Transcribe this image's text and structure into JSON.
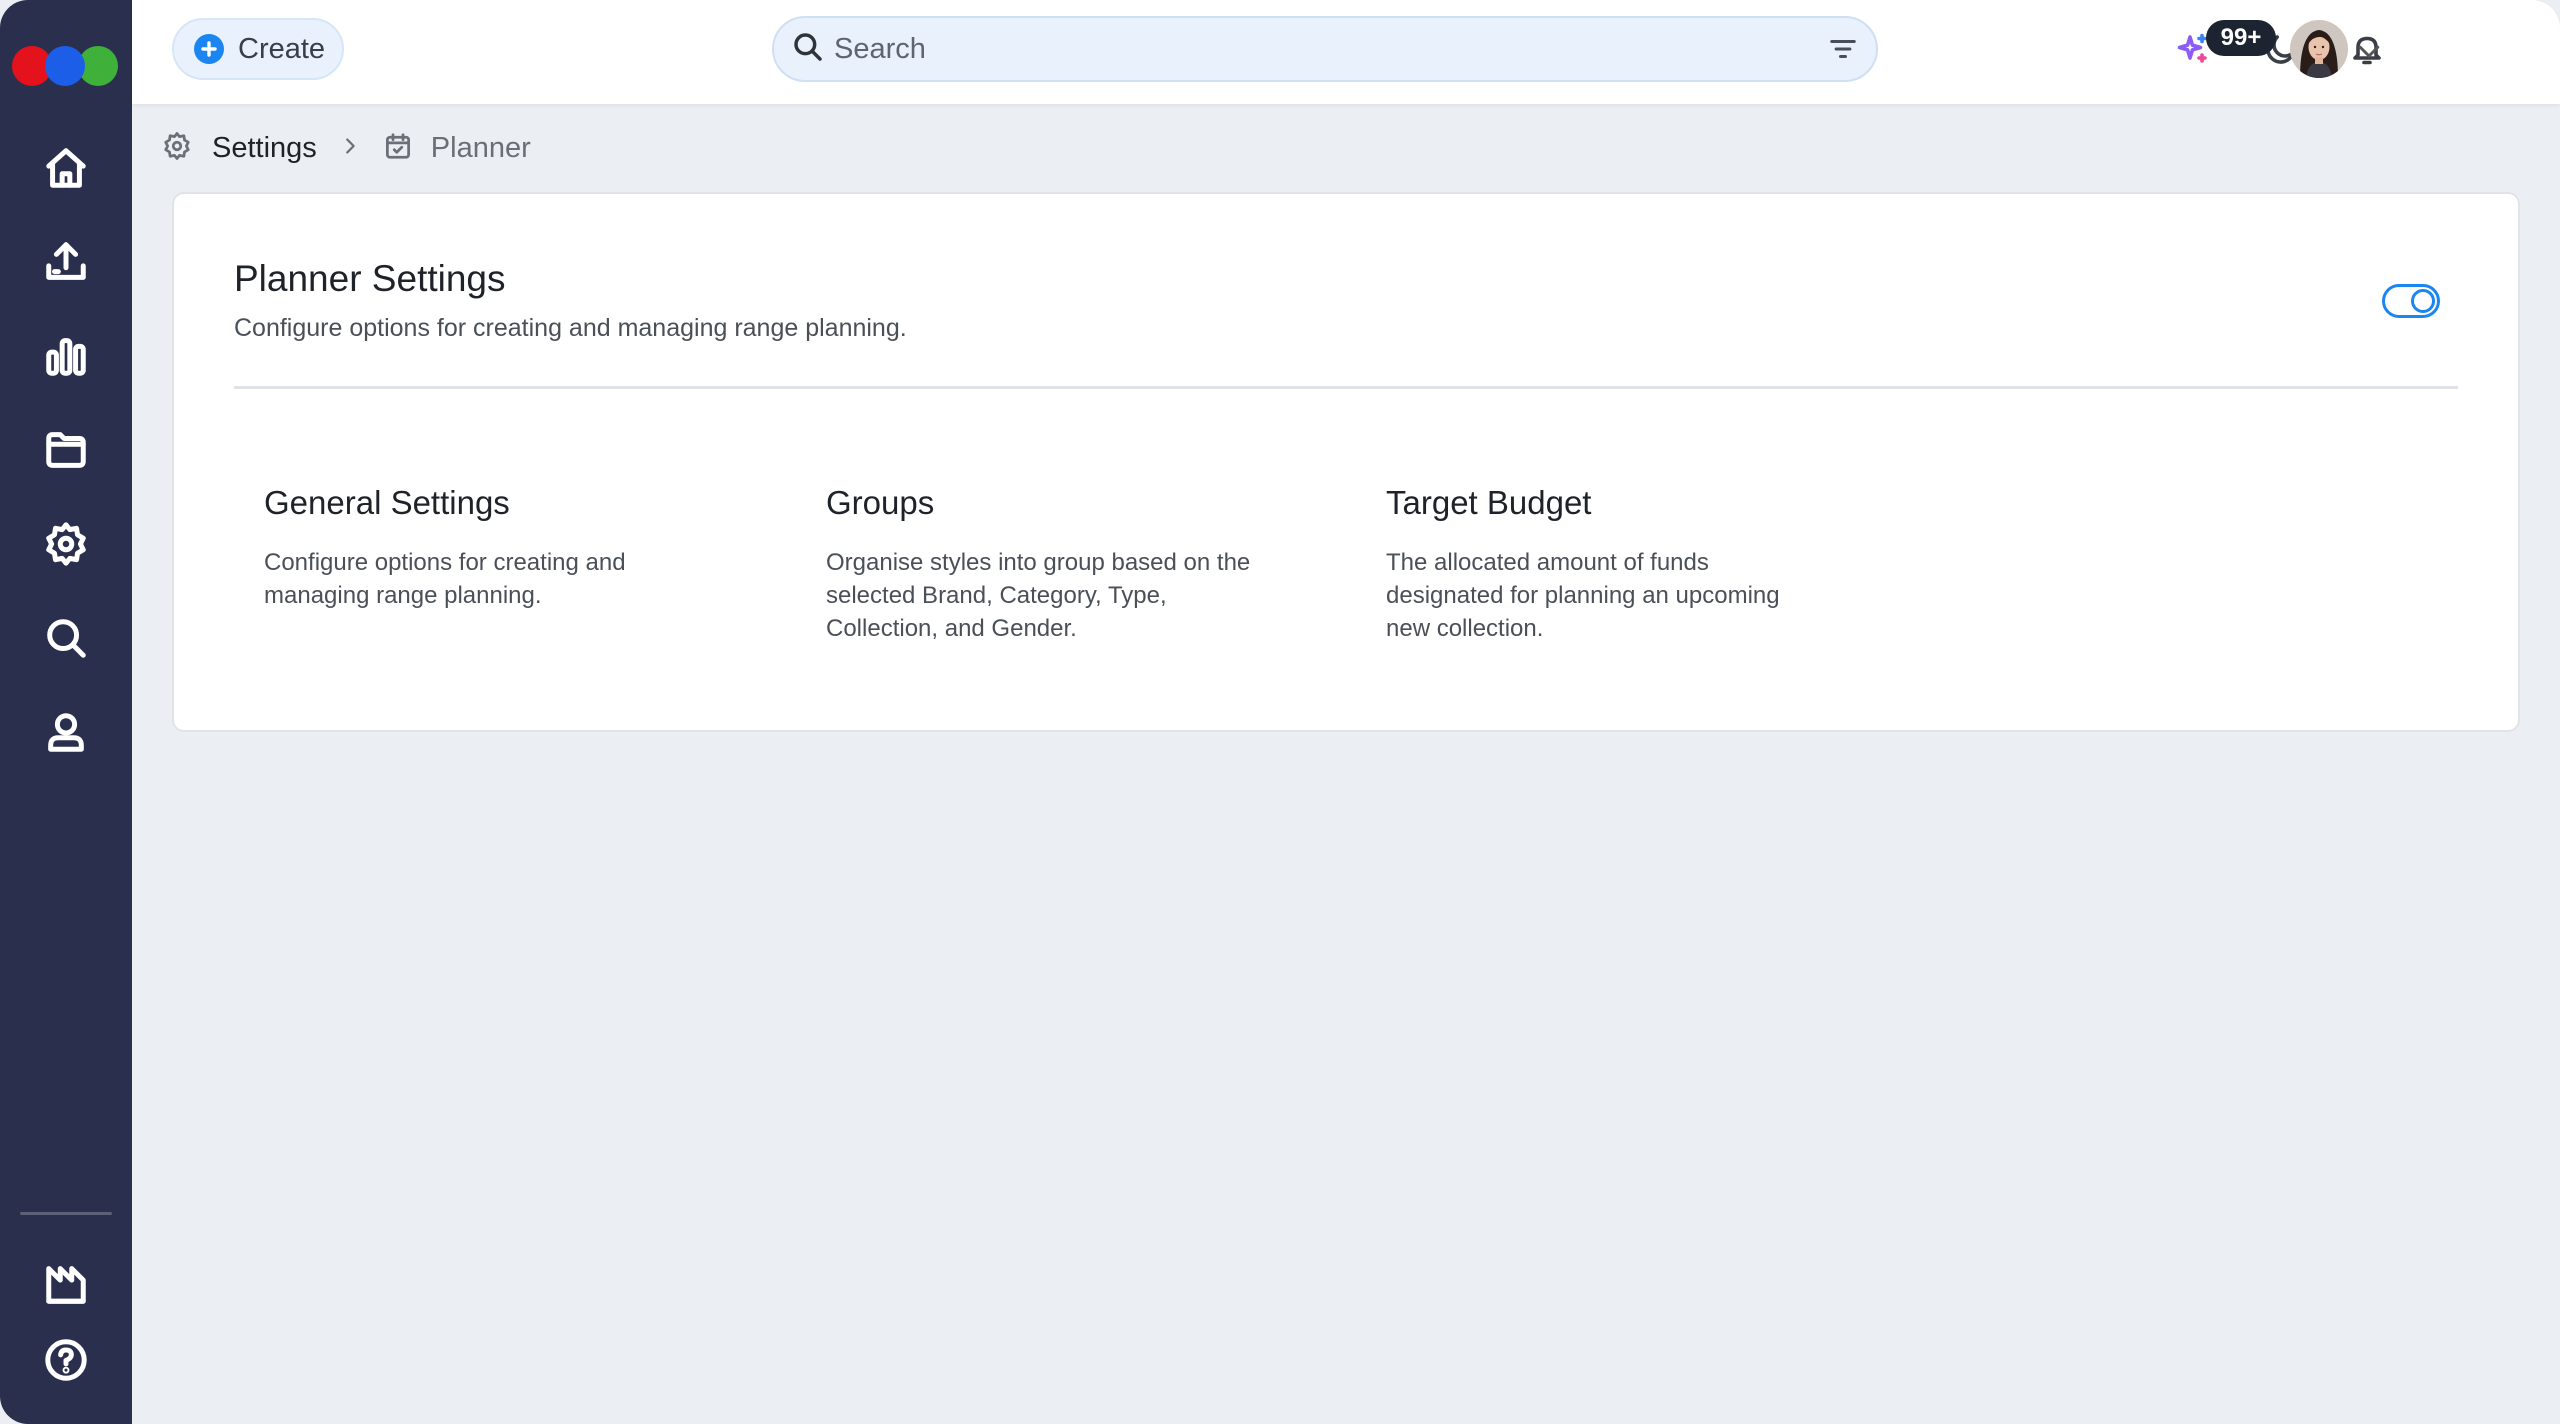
{
  "sidebar": {
    "nav": [
      {
        "name": "home-icon"
      },
      {
        "name": "upload-icon"
      },
      {
        "name": "analytics-icon"
      },
      {
        "name": "folder-icon"
      },
      {
        "name": "settings-icon"
      },
      {
        "name": "search-icon"
      },
      {
        "name": "user-icon"
      }
    ],
    "bottom": [
      {
        "name": "factory-icon"
      },
      {
        "name": "help-icon"
      }
    ],
    "logo_colors": [
      "#e3121c",
      "#1d5ee8",
      "#3fb13a"
    ]
  },
  "topbar": {
    "create_label": "Create",
    "search_placeholder": "Search",
    "notification_count": "99+",
    "accent_color": "#1b86f2"
  },
  "breadcrumb": {
    "parent": "Settings",
    "current": "Planner"
  },
  "card": {
    "title": "Planner Settings",
    "subtitle": "Configure options for creating and managing range planning.",
    "toggle_on": true,
    "sections": [
      {
        "title": "General Settings",
        "description": "Configure options for creating and managing range planning."
      },
      {
        "title": "Groups",
        "description": "Organise styles into group based on the selected Brand, Category, Type, Collection, and Gender."
      },
      {
        "title": "Target Budget",
        "description": "The allocated amount of funds designated for planning an upcoming new collection."
      }
    ]
  }
}
